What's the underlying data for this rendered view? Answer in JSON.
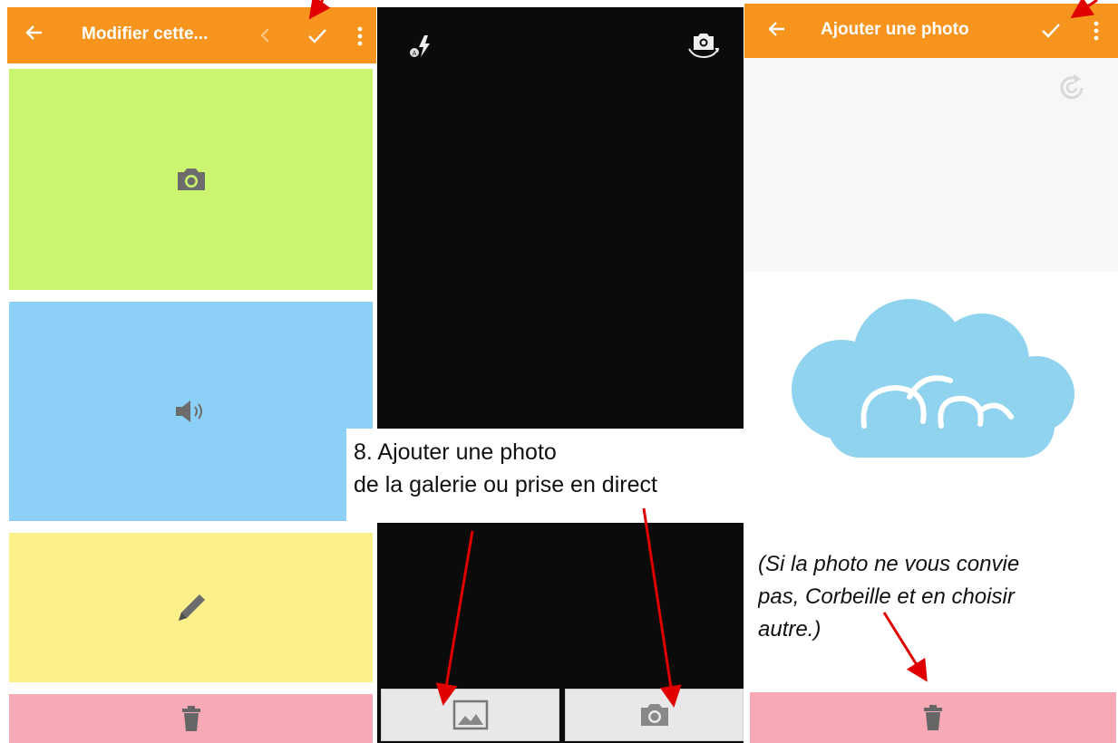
{
  "colors": {
    "appbar": "#f7941d",
    "tile_photo": "#ccf56f",
    "tile_audio": "#8dd0f7",
    "tile_text": "#fbf08a",
    "tile_delete": "#f7a9b5",
    "camera_bg": "#0b0b0b",
    "cloud": "#8fd3ef",
    "arrow": "#e00000"
  },
  "left": {
    "title": "Modifier cette...",
    "tiles": [
      "photo",
      "audio",
      "text",
      "delete"
    ]
  },
  "middle": {
    "icons": [
      "flash-auto-icon",
      "switch-camera-icon"
    ],
    "bottom_buttons": [
      "gallery",
      "camera"
    ]
  },
  "right": {
    "title": "Ajouter une photo",
    "icons": [
      "rotate-icon",
      "trash-icon"
    ]
  },
  "annotations": {
    "step_line1": "8. Ajouter une photo",
    "step_line2": "de la galerie ou prise en direct",
    "hint_line1": "(Si la photo ne vous convie",
    "hint_line2": "pas, Corbeille et en choisir",
    "hint_line3": "autre.)"
  }
}
